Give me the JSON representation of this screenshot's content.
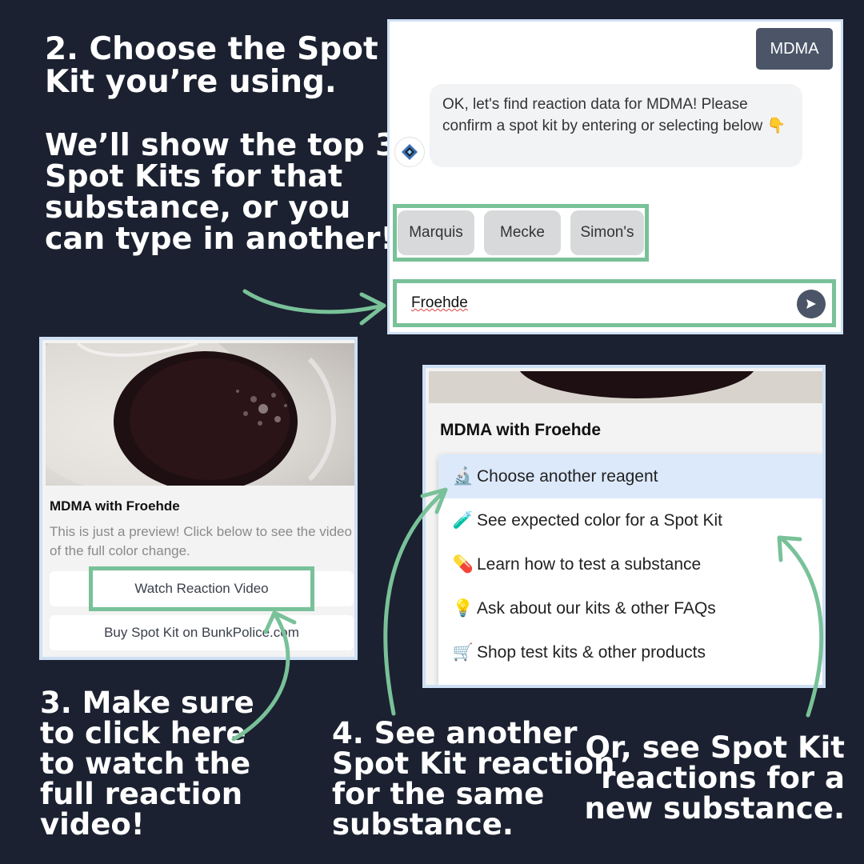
{
  "captions": {
    "step2": [
      "2. Choose the Spot",
      "Kit you’re using."
    ],
    "step2b": [
      "We’ll show the top 3",
      "Spot Kits for that",
      "substance, or you",
      "can type in another!"
    ],
    "step3": [
      "3. Make sure",
      "to click here",
      "to watch the",
      "full reaction",
      "video!"
    ],
    "step4": [
      "4. See another",
      "Spot Kit reaction",
      "for the same",
      "substance."
    ],
    "step5": [
      "Or, see Spot Kit",
      "reactions for a",
      "new substance."
    ]
  },
  "chat": {
    "user_message": "MDMA",
    "bot_message": "OK, let's find reaction data for MDMA! Please confirm a spot kit by entering or selecting below 👇",
    "choices": [
      "Marquis",
      "Mecke",
      "Simon's"
    ],
    "input_value": "Froehde"
  },
  "video_card": {
    "title": "MDMA with Froehde",
    "description": "This is just a preview! Click below to see the video of the full color change.",
    "watch_button": "Watch Reaction Video",
    "buy_button": "Buy Spot Kit on BunkPolice.com"
  },
  "menu_card": {
    "title": "MDMA with Froehde",
    "items": [
      {
        "icon": "🔬",
        "label": "Choose another reagent"
      },
      {
        "icon": "🧪",
        "label": "See expected color for a Spot Kit"
      },
      {
        "icon": "💊",
        "label": "Learn how to test a substance"
      },
      {
        "icon": "💡",
        "label": "Ask about our kits & other FAQs"
      },
      {
        "icon": "🛒",
        "label": "Shop test kits & other products"
      }
    ]
  },
  "colors": {
    "background": "#1b2130",
    "highlight_green": "#79c199",
    "panel_border": "#cfe0f4",
    "user_bubble": "#4b5567"
  }
}
